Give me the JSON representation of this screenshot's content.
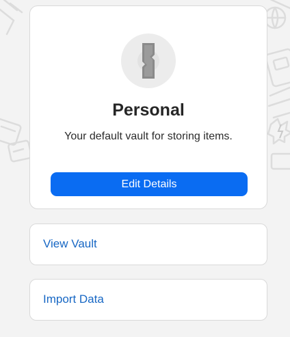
{
  "vault": {
    "icon": "vault-keyhole-icon",
    "title": "Personal",
    "description": "Your default vault for storing items.",
    "edit_label": "Edit Details"
  },
  "actions": {
    "view_vault_label": "View Vault",
    "import_data_label": "Import Data"
  },
  "colors": {
    "background": "#f3f3f3",
    "card": "#ffffff",
    "primary_button": "#0a6cf2",
    "link": "#1767c4"
  }
}
